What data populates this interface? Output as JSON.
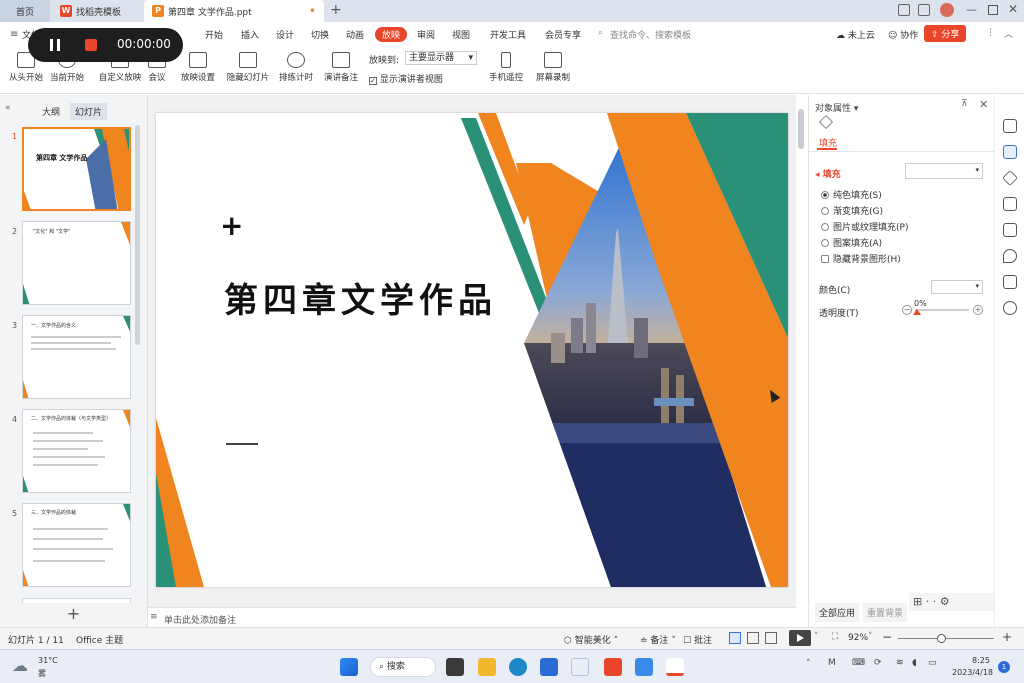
{
  "tabs": {
    "home": "首页",
    "template": "找稻壳模板",
    "file": "第四章 文学作品.ppt"
  },
  "menu": [
    "文件",
    "开始",
    "插入",
    "设计",
    "切换",
    "动画",
    "放映",
    "审阅",
    "视图",
    "开发工具",
    "会员专享"
  ],
  "menu_active": "放映",
  "search_placeholder": "查找命令、搜索模板",
  "top_right": {
    "cloud": "未上云",
    "collab": "协作",
    "share": "分享"
  },
  "recorder_time": "00:00:00",
  "tools": {
    "from_start": "从头开始",
    "from_current": "当前开始",
    "custom": "自定义放映",
    "meeting": "会议",
    "settings": "放映设置",
    "hide": "隐藏幻灯片",
    "rehearse": "排练计时",
    "speaker_notes": "演讲备注",
    "show_to_label": "放映到:",
    "show_to_value": "主要显示器",
    "presenter_view": "显示演讲者视图",
    "phone_remote": "手机遥控",
    "screen_record": "屏幕录制"
  },
  "panel_tabs": {
    "outline": "大纲",
    "slides": "幻灯片"
  },
  "thumbs": [
    {
      "num": "1",
      "title": "第四章 文学作品"
    },
    {
      "num": "2",
      "title": "\"文化\"  和 \"文学\""
    },
    {
      "num": "3",
      "title": "一、文学作品的含义"
    },
    {
      "num": "4",
      "title": "二、文学作品的体裁（与文学类型）"
    },
    {
      "num": "5",
      "title": "三、文学作品的体裁"
    }
  ],
  "slide": {
    "plus": "+",
    "title": "第四章文学作品"
  },
  "notes_placeholder": "单击此处添加备注",
  "props": {
    "header": "对象属性",
    "fill_tab": "填充",
    "fill_section": "填充",
    "options": [
      "纯色填充(S)",
      "渐变填充(G)",
      "图片或纹理填充(P)",
      "图案填充(A)"
    ],
    "hide_bg": "隐藏背景图形(H)",
    "color_label": "颜色(C)",
    "transparency_label": "透明度(T)",
    "transparency_value": "0%",
    "apply_all": "全部应用",
    "reset_bg": "重置背景"
  },
  "status": {
    "slide_info": "幻灯片 1 / 11",
    "theme": "Office 主题",
    "beautify": "智能美化",
    "notes": "备注",
    "comment": "批注",
    "zoom": "92%"
  },
  "taskbar": {
    "temp": "31°C",
    "weather": "雾",
    "search": "搜索",
    "time": "8:25",
    "date": "2023/4/18",
    "notify": "1"
  },
  "colors": {
    "accent": "#e8452b",
    "orange": "#f0841f",
    "teal": "#2a9178"
  }
}
